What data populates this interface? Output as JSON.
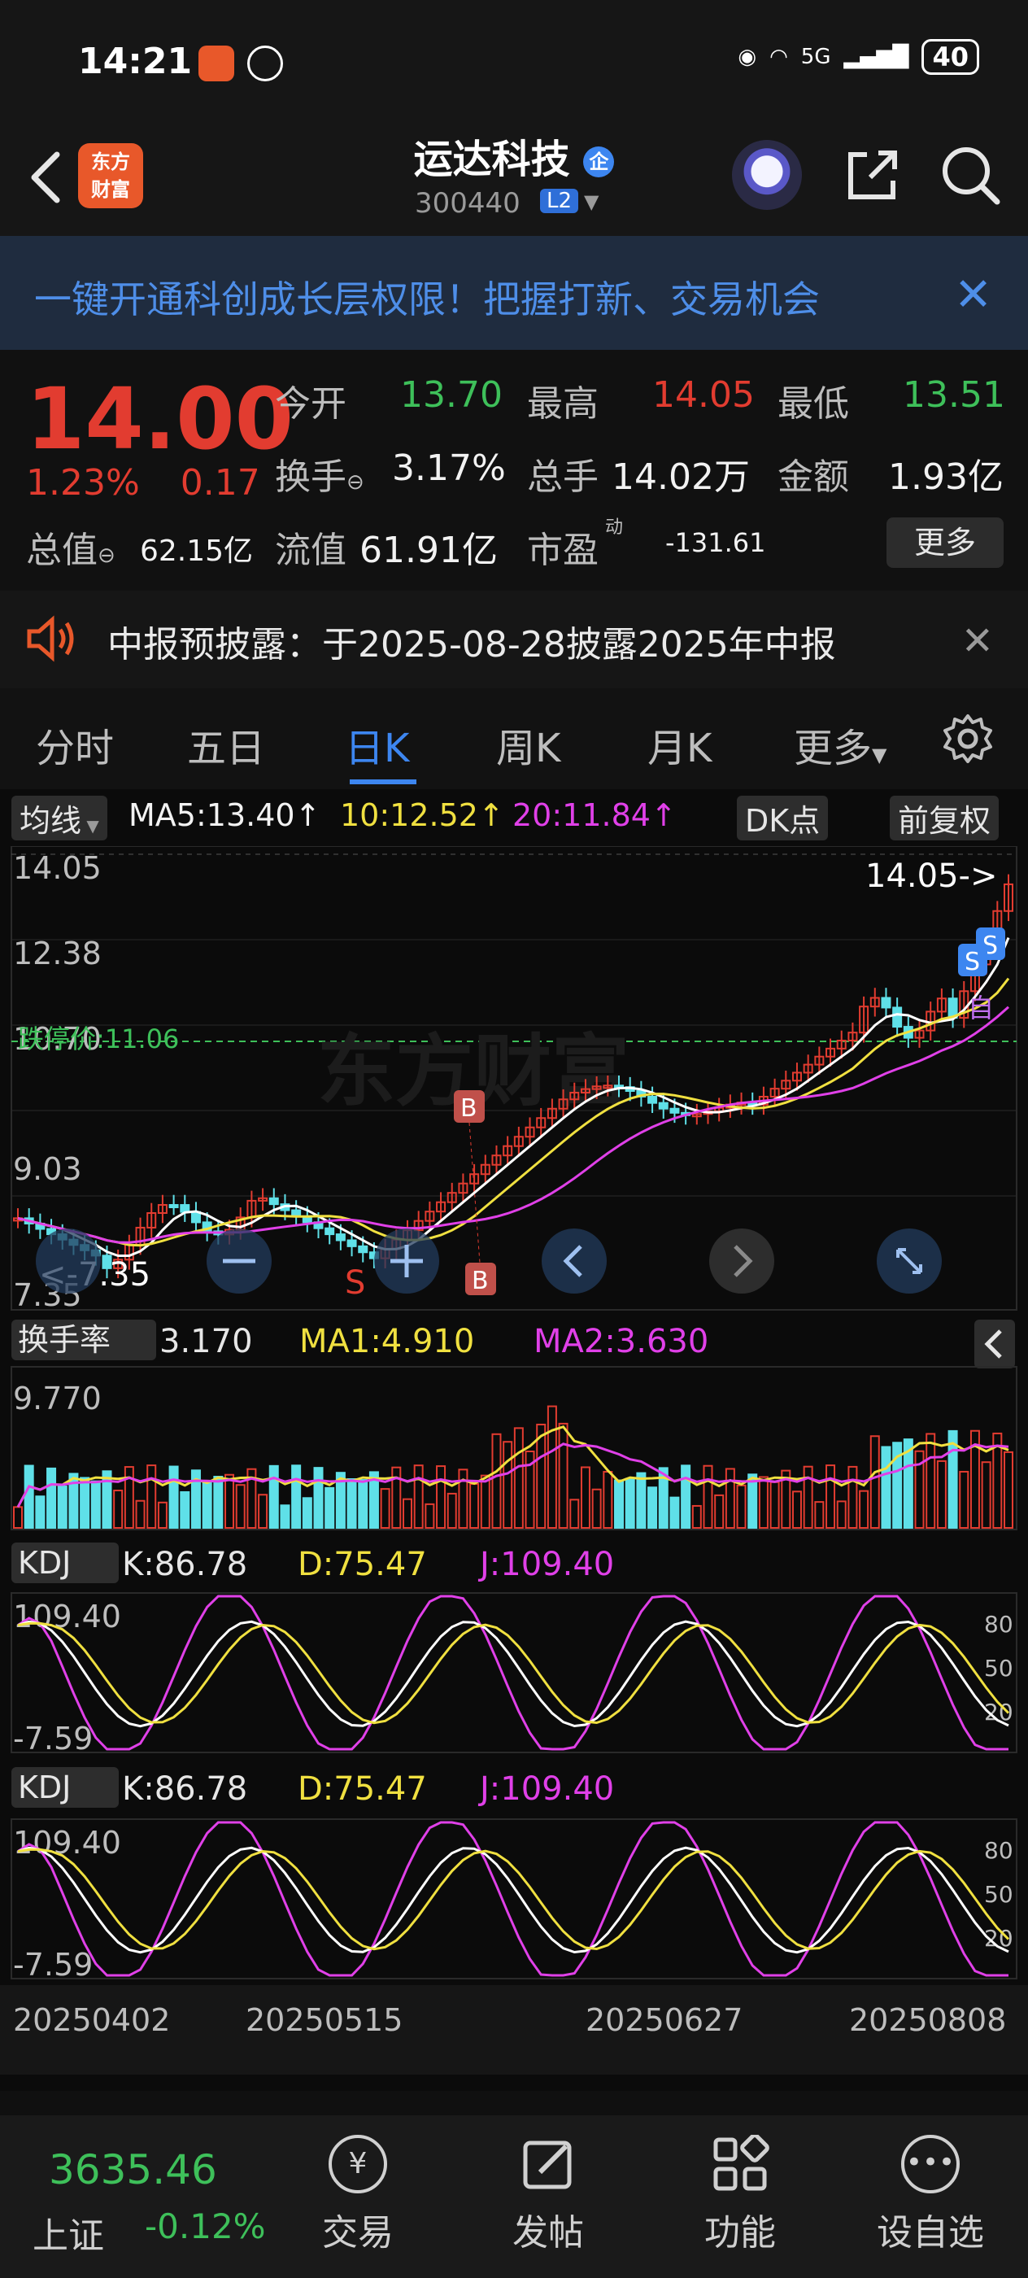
{
  "status_bar": {
    "time": "14:21",
    "network": "5G",
    "battery": "40"
  },
  "header": {
    "logo_line1": "东方",
    "logo_line2": "财富",
    "stock_name": "运达科技",
    "stock_badge": "企",
    "stock_code": "300440",
    "level_badge": "L2"
  },
  "banner": {
    "text": "一键开通科创成长层权限！把握打新、交易机会"
  },
  "quote": {
    "price": "14.00",
    "change_pct": "1.23%",
    "change_amt": "0.17",
    "open_label": "今开",
    "open": "13.70",
    "high_label": "最高",
    "high": "14.05",
    "low_label": "最低",
    "low": "13.51",
    "turnover_label": "换手",
    "turnover": "3.17%",
    "volume_label": "总手",
    "volume": "14.02万",
    "amount_label": "金额",
    "amount": "1.93亿",
    "total_cap_label": "总值",
    "total_cap": "62.15亿",
    "float_cap_label": "流值",
    "float_cap": "61.91亿",
    "pe_label": "市盈",
    "pe_sup": "动",
    "pe": "-131.61",
    "more_button": "更多"
  },
  "notice": {
    "text": "中报预披露：于2025-08-28披露2025年中报"
  },
  "tabs": [
    "分时",
    "五日",
    "日K",
    "周K",
    "月K",
    "更多"
  ],
  "active_tab": "日K",
  "kline_panel": {
    "indicator_select": "均线",
    "ma5": "MA5:13.40",
    "ma10": "10:12.52",
    "ma20": "20:11.84",
    "dk_button": "DK点",
    "adjust_button": "前复权",
    "y_ticks": [
      "14.05",
      "12.38",
      "10.70",
      "9.03",
      "7.35"
    ],
    "max_label": "14.05->",
    "min_label": "<-7.35",
    "limit_down_label": "跌停价:11.06",
    "watermark": "东方财富",
    "b_marker": "B",
    "s_marker": "S",
    "zi_marker": "自"
  },
  "turnover_panel": {
    "indicator_select": "换手率",
    "value": "3.170",
    "ma1": "MA1:4.910",
    "ma2": "MA2:3.630",
    "y_tick": "9.770"
  },
  "kdj_panel_1": {
    "indicator_select": "KDJ",
    "k": "K:86.78",
    "d": "D:75.47",
    "j": "J:109.40",
    "y_top": "109.40",
    "y_bottom": "-7.59",
    "levels": [
      "80",
      "50",
      "20"
    ]
  },
  "kdj_panel_2": {
    "indicator_select": "KDJ",
    "k": "K:86.78",
    "d": "D:75.47",
    "j": "J:109.40",
    "y_top": "109.40",
    "y_bottom": "-7.59",
    "levels": [
      "80",
      "50",
      "20"
    ]
  },
  "x_axis_dates": [
    "20250402",
    "20250515",
    "20250627",
    "20250808"
  ],
  "bottom_nav": {
    "index_value": "3635.46",
    "index_name": "上证",
    "index_change": "-0.12%",
    "items": [
      "交易",
      "发帖",
      "功能",
      "设自选"
    ]
  },
  "colors": {
    "up": "#e23c30",
    "down": "#3ec05a",
    "accent": "#3d86f0",
    "ma5": "#ffffff",
    "ma10": "#f0e040",
    "ma20": "#e040e8",
    "down_candle": "#5fe0e8"
  },
  "chart_data": {
    "type": "candlestick",
    "ylim": [
      7.35,
      14.05
    ],
    "ma_values": {
      "MA5": 13.4,
      "MA10": 12.52,
      "MA20": 11.84
    },
    "last_close": 14.0
  }
}
